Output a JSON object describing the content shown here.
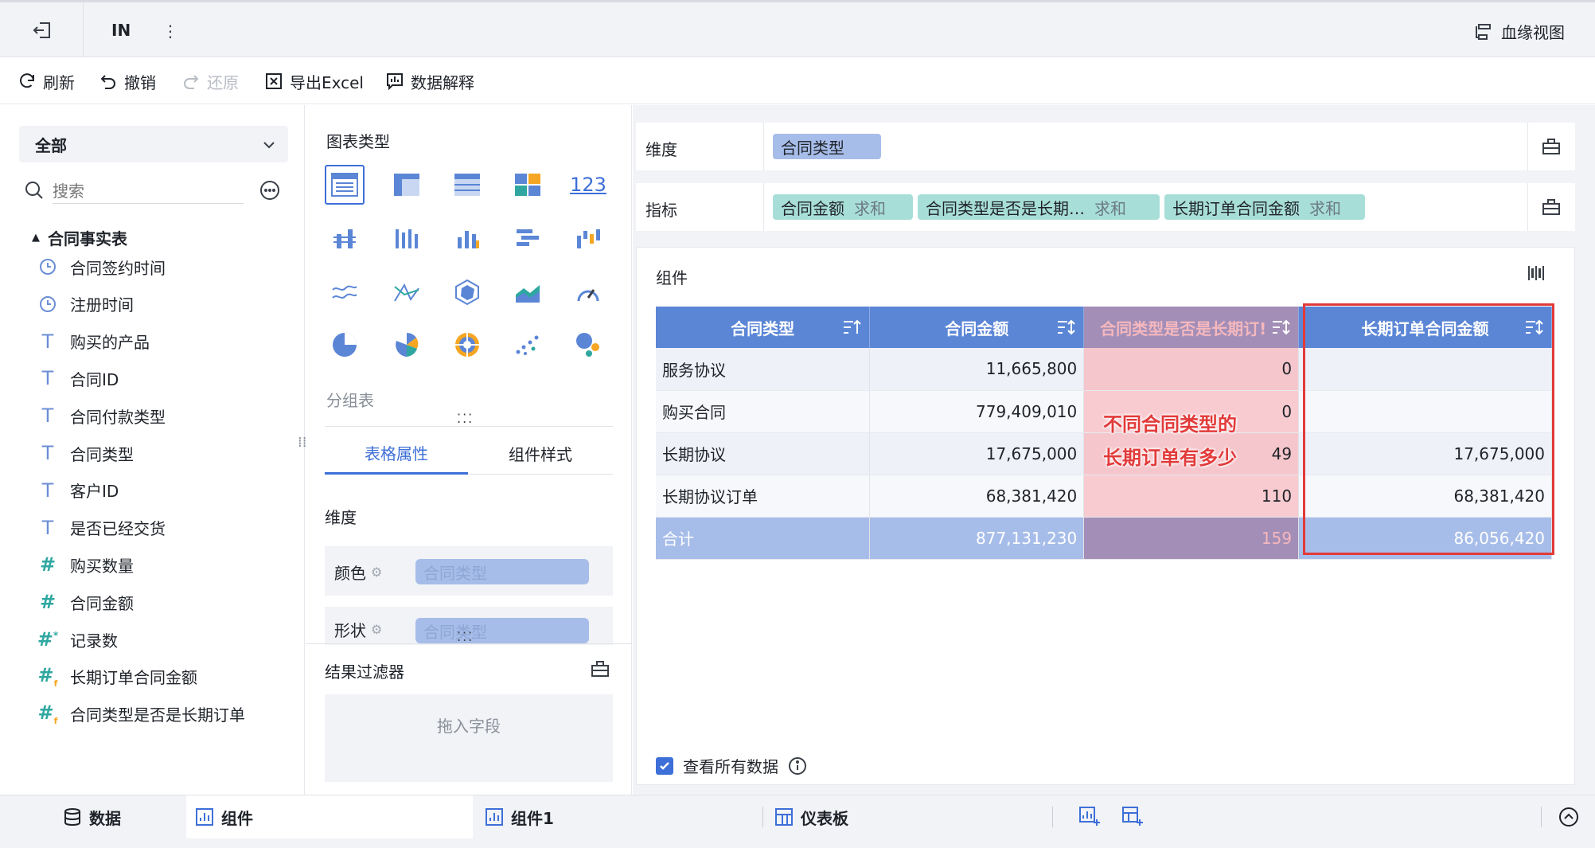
{
  "topbar": {
    "title": "IN",
    "lineage_label": "血缘视图"
  },
  "toolbar": {
    "refresh": "刷新",
    "undo": "撤销",
    "redo": "还原",
    "export_excel": "导出Excel",
    "data_explain": "数据解释"
  },
  "left": {
    "dropdown_value": "全部",
    "search_placeholder": "搜索",
    "table_name": "合同事实表",
    "fields": [
      {
        "label": "合同签约时间",
        "type": "time"
      },
      {
        "label": "注册时间",
        "type": "time"
      },
      {
        "label": "购买的产品",
        "type": "text"
      },
      {
        "label": "合同ID",
        "type": "text"
      },
      {
        "label": "合同付款类型",
        "type": "text"
      },
      {
        "label": "合同类型",
        "type": "text"
      },
      {
        "label": "客户ID",
        "type": "text"
      },
      {
        "label": "是否已经交货",
        "type": "text"
      },
      {
        "label": "购买数量",
        "type": "number"
      },
      {
        "label": "合同金额",
        "type": "number"
      },
      {
        "label": "记录数",
        "type": "number-record"
      },
      {
        "label": "长期订单合同金额",
        "type": "number-calc"
      },
      {
        "label": "合同类型是否是长期订单",
        "type": "number-calc"
      }
    ]
  },
  "mid": {
    "chart_type_title": "图表类型",
    "chart_123_label": "123",
    "group_table_label": "分组表",
    "tabs": [
      "表格属性",
      "组件样式"
    ],
    "dimension_title": "维度",
    "color_label": "颜色",
    "color_value": "合同类型",
    "shape_label": "形状",
    "shape_value": "合同类型",
    "result_filter": "结果过滤器",
    "drop_field": "拖入字段"
  },
  "right": {
    "dimension_label": "维度",
    "dimension_pill": "合同类型",
    "metric_label": "指标",
    "metric_pills": [
      {
        "name": "合同金额",
        "agg": "求和"
      },
      {
        "name": "合同类型是否是长期…",
        "agg": "求和"
      },
      {
        "name": "长期订单合同金额",
        "agg": "求和"
      }
    ],
    "component_title": "组件",
    "table": {
      "headers": [
        "合同类型",
        "合同金额",
        "合同类型是否是长期订!",
        "长期订单合同金额"
      ],
      "rows": [
        [
          "服务协议",
          "11,665,800",
          "0",
          ""
        ],
        [
          "购买合同",
          "779,409,010",
          "0",
          ""
        ],
        [
          "长期协议",
          "17,675,000",
          "49",
          "17,675,000"
        ],
        [
          "长期协议订单",
          "68,381,420",
          "110",
          "68,381,420"
        ]
      ],
      "total": [
        "合计",
        "877,131,230",
        "159",
        "86,056,420"
      ]
    },
    "annotation_lines": [
      "不同合同类型的",
      "长期订单有多少"
    ],
    "view_all_label": "查看所有数据",
    "accent_color": "#5b86d6",
    "highlight_color": "#f5b8be",
    "box_color": "#e23a3a"
  },
  "bottom": {
    "data_tab": "数据",
    "tabs": [
      "组件",
      "组件1",
      "仪表板"
    ]
  }
}
